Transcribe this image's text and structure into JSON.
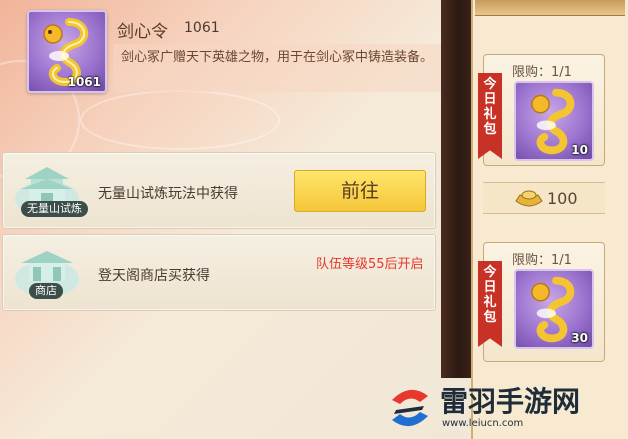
{
  "item": {
    "name": "剑心令",
    "count": "1061",
    "badge_count": "1061",
    "description": "剑心冢广赠天下英雄之物，用于在剑心冢中铸造装备。",
    "icon": "golden-dragon-icon"
  },
  "sources": [
    {
      "tag": "无量山试炼",
      "text": "无量山试炼玩法中获得",
      "button": "前往",
      "icon": "pavilion-icon"
    },
    {
      "tag": "商店",
      "text": "登天阁商店买获得",
      "locked_text": "队伍等级55后开启",
      "icon": "pavilion-icon"
    }
  ],
  "gift_cards": [
    {
      "ribbon": "今日礼包",
      "limit": "限购：1/1",
      "item_count": "10",
      "price": "100",
      "currency_icon": "gold-ingot-icon"
    },
    {
      "ribbon": "今日礼包",
      "limit": "限购：1/1",
      "item_count": "30"
    }
  ],
  "watermark": {
    "brand": "雷羽手游网",
    "url": "www.leiucn.com"
  },
  "colors": {
    "accent_red": "#e8382d",
    "button_yellow": "#f4c63a",
    "rarity_purple": "#9c74cf"
  }
}
